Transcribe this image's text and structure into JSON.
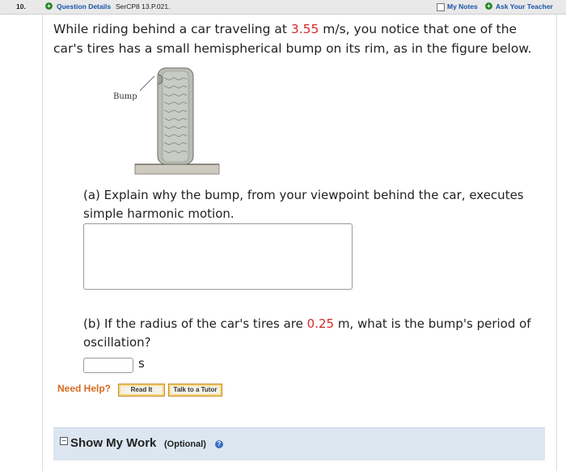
{
  "header": {
    "question_number": "10.",
    "question_details_label": "Question Details",
    "problem_code": "SerCP8 13.P.021.",
    "my_notes_label": "My Notes",
    "ask_teacher_label": "Ask Your Teacher"
  },
  "question": {
    "intro_before_speed": "While riding behind a car traveling at ",
    "speed_value": "3.55",
    "intro_after_speed": " m/s, you notice that one of the car's tires has a small hemispherical bump on its rim, as in the figure below."
  },
  "figure": {
    "bump_label": "Bump"
  },
  "part_a": {
    "text": "(a) Explain why the bump, from your viewpoint behind the car, executes simple harmonic motion.",
    "answer_value": ""
  },
  "part_b": {
    "text_before_radius": "(b) If the radius of the car's tires are ",
    "radius_value": "0.25",
    "text_after_radius": " m, what is the bump's period of oscillation?",
    "answer_value": "",
    "unit": "s"
  },
  "help": {
    "label": "Need Help?",
    "read_it_label": "Read It",
    "talk_to_tutor_label": "Talk to a Tutor"
  },
  "show_work": {
    "toggle_symbol": "−",
    "title": "Show My Work",
    "optional_label": "(Optional)",
    "help_symbol": "?"
  },
  "icons": {
    "question_details": "plus-circle-icon",
    "notes_checkbox": "checkbox-icon",
    "ask_teacher": "plus-circle-icon",
    "show_work_toggle": "collapse-icon",
    "show_work_help": "help-circle-icon"
  },
  "colors": {
    "highlight_value": "#d12a2a",
    "link": "#1a55a8",
    "need_help": "#d76b1e",
    "show_work_bg": "#dbe6f1"
  }
}
